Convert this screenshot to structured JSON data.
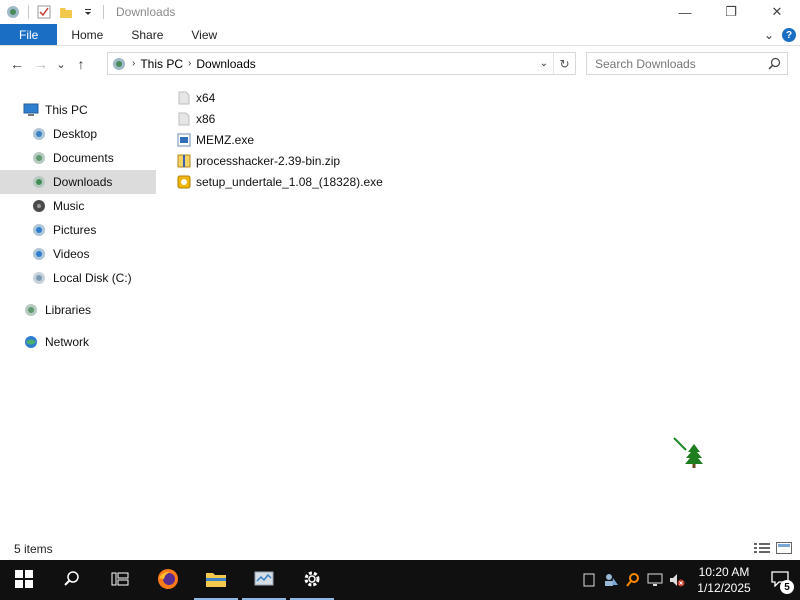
{
  "window": {
    "title": "Downloads",
    "controls": {
      "minimize": "—",
      "maximize": "❐",
      "close": "✕"
    }
  },
  "ribbon": {
    "tabs": [
      "File",
      "Home",
      "Share",
      "View"
    ],
    "expand_glyph": "⌄",
    "help_glyph": "?"
  },
  "nav": {
    "back_glyph": "←",
    "forward_glyph": "→",
    "recent_glyph": "⌄",
    "up_glyph": "↑",
    "breadcrumb": [
      "This PC",
      "Downloads"
    ],
    "crumb_sep": "›",
    "dropdown_glyph": "⌄",
    "refresh_glyph": "↻"
  },
  "search": {
    "placeholder": "Search Downloads"
  },
  "sidebar": {
    "items": [
      {
        "label": "This PC",
        "icon": "computer-icon"
      },
      {
        "label": "Desktop",
        "icon": "desktop-icon"
      },
      {
        "label": "Documents",
        "icon": "documents-icon"
      },
      {
        "label": "Downloads",
        "icon": "downloads-icon",
        "selected": true
      },
      {
        "label": "Music",
        "icon": "music-icon"
      },
      {
        "label": "Pictures",
        "icon": "pictures-icon"
      },
      {
        "label": "Videos",
        "icon": "videos-icon"
      },
      {
        "label": "Local Disk (C:)",
        "icon": "disk-icon"
      },
      {
        "label": "Libraries",
        "icon": "libraries-icon"
      },
      {
        "label": "Network",
        "icon": "network-icon"
      }
    ]
  },
  "files": [
    {
      "name": "x64",
      "icon": "folder-icon"
    },
    {
      "name": "x86",
      "icon": "folder-icon"
    },
    {
      "name": "MEMZ.exe",
      "icon": "exe-icon"
    },
    {
      "name": "processhacker-2.39-bin.zip",
      "icon": "zip-icon"
    },
    {
      "name": "setup_undertale_1.08_(18328).exe",
      "icon": "installer-icon"
    }
  ],
  "status": {
    "text": "5 items"
  },
  "taskbar": {
    "apps": [
      "start-icon",
      "search-icon",
      "task-view-icon",
      "firefox-icon",
      "file-explorer-icon",
      "task-manager-icon",
      "settings-icon"
    ],
    "clock_time": "10:20 AM",
    "clock_date": "1/12/2025",
    "notification_count": "5"
  },
  "colors": {
    "accent": "#1a6fc4",
    "taskbar": "#101010",
    "selection": "#dcdcdc"
  }
}
